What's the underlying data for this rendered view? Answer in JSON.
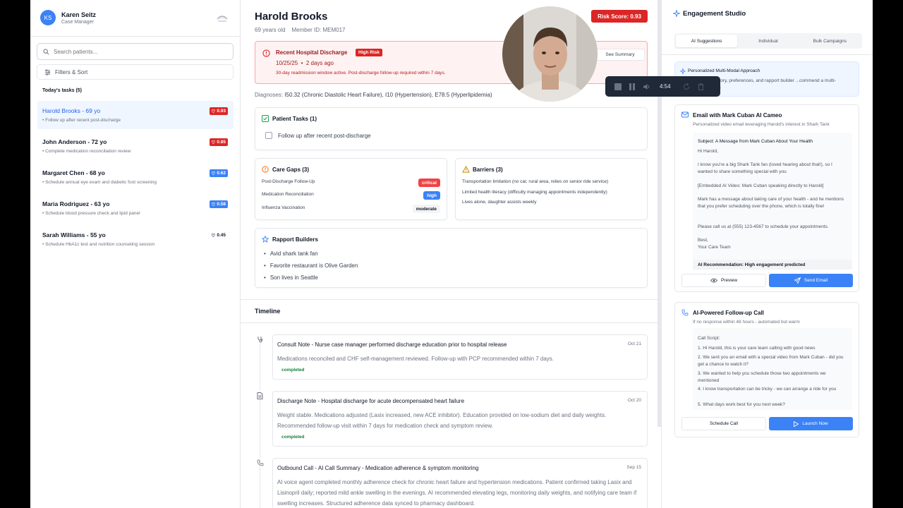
{
  "sidebar": {
    "user": {
      "initials": "KS",
      "name": "Karen Seitz",
      "role": "Case Manager"
    },
    "search": {
      "placeholder": "Search patients..."
    },
    "filters_label": "Filters & Sort",
    "tasks_title": "Today's tasks (5)",
    "patients": [
      {
        "name": "Harold Brooks - 69 yo",
        "task": "Follow up after recent post-discharge",
        "score": "0.93",
        "color": "#dc2626"
      },
      {
        "name": "John Anderson - 72 yo",
        "task": "Complete medication reconciliation review",
        "score": "0.85",
        "color": "#dc2626"
      },
      {
        "name": "Margaret Chen - 68 yo",
        "task": "Schedule annual eye exam and diabetic foot screening",
        "score": "0.62",
        "color": "#3b82f6"
      },
      {
        "name": "Maria Rodriguez - 63 yo",
        "task": "Schedule blood pressure check and lipid panel",
        "score": "0.58",
        "color": "#3b82f6"
      },
      {
        "name": "Sarah Williams - 55 yo",
        "task": "Schedule HbA1c test and nutrition counseling session",
        "score": "0.45",
        "color": "none"
      }
    ]
  },
  "main": {
    "patient_name": "Harold Brooks",
    "age": "69 years old",
    "member_id": "Member ID: MEM017",
    "risk_score": "Risk Score: 0.93",
    "alert": {
      "title": "Recent Hospital Discharge",
      "badge": "High Risk",
      "date": "10/25/25",
      "ago": "2 days ago",
      "message": "30-day readmission window active. Post-discharge follow-up required within 7 days.",
      "button": "See Summary"
    },
    "diagnoses_label": "Diagnoses:",
    "diagnoses": "I50.32 (Chronic Diastolic Heart Failure), I10 (Hypertension), E78.5 (Hyperlipidemia)",
    "patient_tasks": {
      "title": "Patient Tasks (1)",
      "items": [
        "Follow up after recent post-discharge"
      ]
    },
    "care_gaps": {
      "title": "Care Gaps (3)",
      "items": [
        {
          "label": "Post-Discharge Follow-Up",
          "severity": "critical"
        },
        {
          "label": "Medication Reconciliation",
          "severity": "high"
        },
        {
          "label": "Influenza Vaccination",
          "severity": "moderate"
        }
      ]
    },
    "barriers": {
      "title": "Barriers (3)",
      "items": [
        "Transportation limitation (no car, rural area, relies on senior ride service)",
        "Limited health literacy (difficulty managing appointments independently)",
        "Lives alone, daughter assists weekly"
      ]
    },
    "rapport": {
      "title": "Rapport Builders",
      "items": [
        "Avid shark tank fan",
        "Favorite restaurant is Olive Garden",
        "Son lives in Seattle"
      ]
    },
    "timeline": {
      "title": "Timeline",
      "items": [
        {
          "title": "Consult Note - Nurse case manager performed discharge education prior to hospital release",
          "date": "Oct 21",
          "body": "Medications reconciled and CHF self-management reviewed. Follow-up with PCP recommended within 7 days.",
          "status": "completed"
        },
        {
          "title": "Discharge Note - Hospital discharge for acute decompensated heart failure",
          "date": "Oct 20",
          "body": "Weight stable. Medications adjusted (Lasix increased, new ACE inhibitor). Education provided on low-sodium diet and daily weights. Recommended follow-up visit within 7 days for medication check and symptom review.",
          "status": "completed"
        },
        {
          "title": "Outbound Call - AI Call Summary - Medication adherence & symptom monitoring",
          "date": "Sep 15",
          "body": "AI voice agent completed monthly adherence check for chronic heart failure and hypertension medications. Patient confirmed taking Lasix and Lisinopril daily; reported mild ankle swelling in the evenings. AI recommended elevating legs, monitoring daily weights, and notifying care team if swelling increases. Structured adherence data synced to pharmacy dashboard.",
          "status": ""
        }
      ]
    }
  },
  "video_overlay": {
    "time": "4:54"
  },
  "right": {
    "title": "Engagement Studio",
    "tabs": [
      "AI Suggestions",
      "Individual",
      "Bulk Campaigns"
    ],
    "personalized": {
      "title": "Personalized Multi-Modal Approach",
      "desc": "...gagement history, preferences, and rapport builder ...commend a multi-modal approach"
    },
    "email": {
      "title": "Email with Mark Cuban AI Cameo",
      "subtitle": "Personalized video email leveraging Harold's interest in Shark Tank",
      "subject": "Subject: A Message from Mark Cuban About Your Health",
      "lines": [
        "Hi Harold,",
        "I know you're a big Shark Tank fan (loved hearing about that!), so I wanted to share something special with you",
        "[Embedded AI Video: Mark Cuban speaking directly to Harold]",
        "Mark has a message about taking care of your health - and he mentions that you prefer scheduling over the phone, which is totally fine!",
        "Please call us at (555) 123-4567 to schedule your appointments.",
        "Best,",
        "Your Care Team"
      ],
      "recommendation": "AI Recommendation: High engagement predicted",
      "preview": "Preview",
      "send": "Send Email"
    },
    "call": {
      "title": "AI-Powered Follow-up Call",
      "subtitle": "If no response within 48 hours - automated but warm",
      "script_label": "Call Script:",
      "lines": [
        "1. Hi Harold, this is your care team calling with good news",
        "2. We sent you an email with a special video from Mark Cuban - did you get a chance to watch it?",
        "3. We wanted to help you schedule those two appointments we mentioned",
        "4. I know transportation can be tricky - we can arrange a ride for you",
        "5. What days work best for you next week?"
      ],
      "schedule": "Schedule Call",
      "launch": "Launch Now"
    }
  }
}
